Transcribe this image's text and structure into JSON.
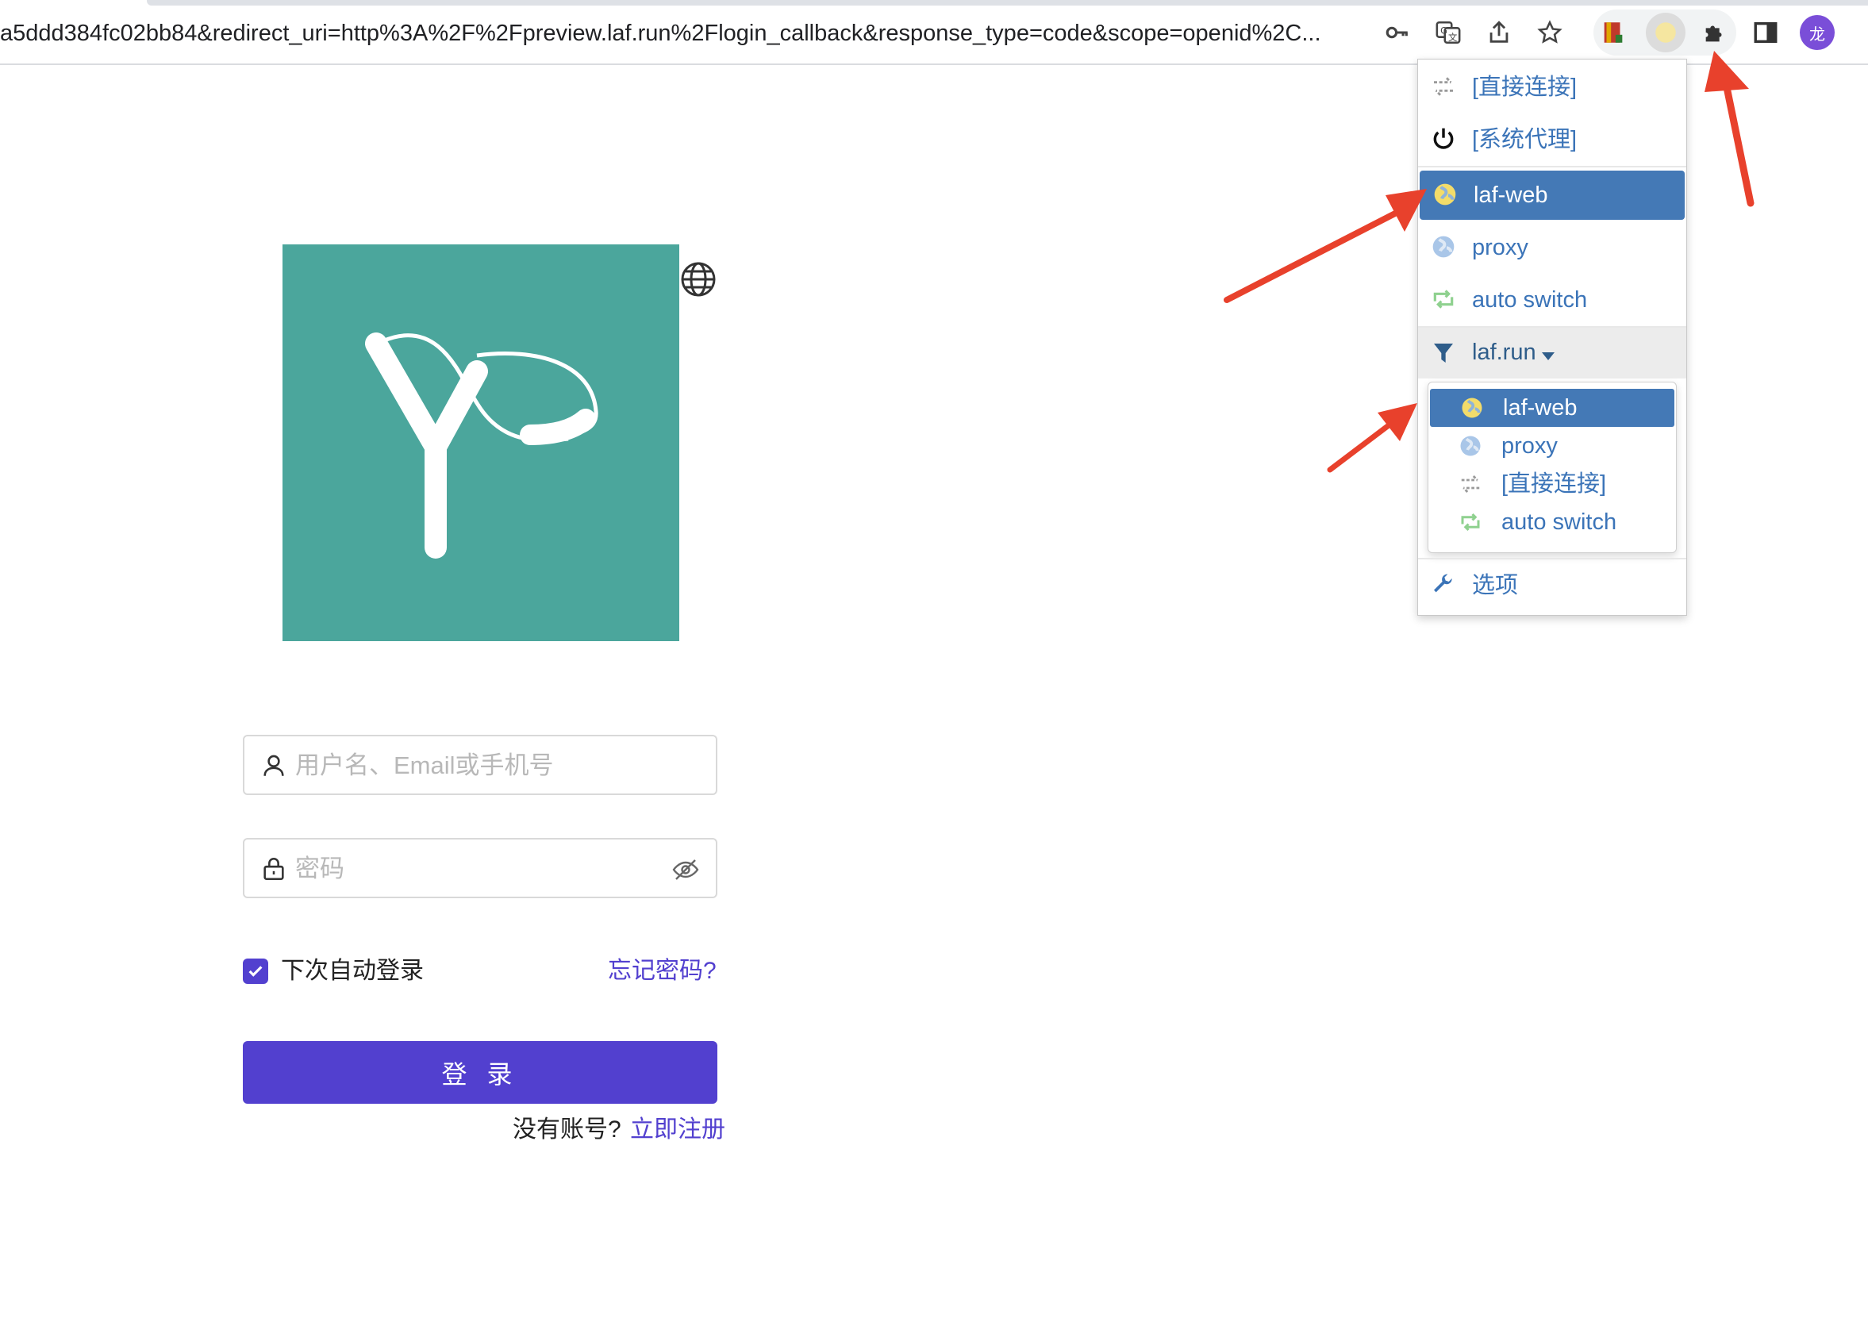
{
  "browser": {
    "url": "a5ddd384fc02bb84&redirect_uri=http%3A%2F%2Fpreview.laf.run%2Flogin_callback&response_type=code&scope=openid%2C...",
    "avatar_text": "龙",
    "toolbar_icons": [
      "key-icon",
      "translate-icon",
      "share-icon",
      "star-icon",
      "extension-book-icon",
      "extension-proxy-icon",
      "puzzle-icon",
      "sidepanel-icon"
    ]
  },
  "login": {
    "username_placeholder": "用户名、Email或手机号",
    "password_placeholder": "密码",
    "remember_label": "下次自动登录",
    "remember_checked": true,
    "forgot_label": "忘记密码?",
    "login_button": "登 录",
    "no_account": "没有账号?",
    "signup_link": "立即注册",
    "brand_color": "#5240cf",
    "logo_color": "#4ba69c"
  },
  "proxy_menu": {
    "items": [
      {
        "label": "[直接连接]",
        "icon": "direct-connect-icon"
      },
      {
        "label": "[系统代理]",
        "icon": "power-icon"
      },
      {
        "label": "laf-web",
        "icon": "globe-icon",
        "selected": true
      },
      {
        "label": "proxy",
        "icon": "globe-icon"
      },
      {
        "label": "auto switch",
        "icon": "auto-switch-icon"
      }
    ],
    "condition": {
      "label": "laf.run",
      "icon": "filter-icon"
    },
    "submenu": [
      {
        "label": "laf-web",
        "icon": "globe-icon",
        "selected": true
      },
      {
        "label": "proxy",
        "icon": "globe-icon"
      },
      {
        "label": "[直接连接]",
        "icon": "direct-connect-icon"
      },
      {
        "label": "auto switch",
        "icon": "auto-switch-icon"
      }
    ],
    "options": {
      "label": "选项",
      "icon": "wrench-icon"
    },
    "selected_color": "#4479b6",
    "link_color": "#3b74b8"
  },
  "annotations": {
    "arrow_color": "#e8412c"
  }
}
